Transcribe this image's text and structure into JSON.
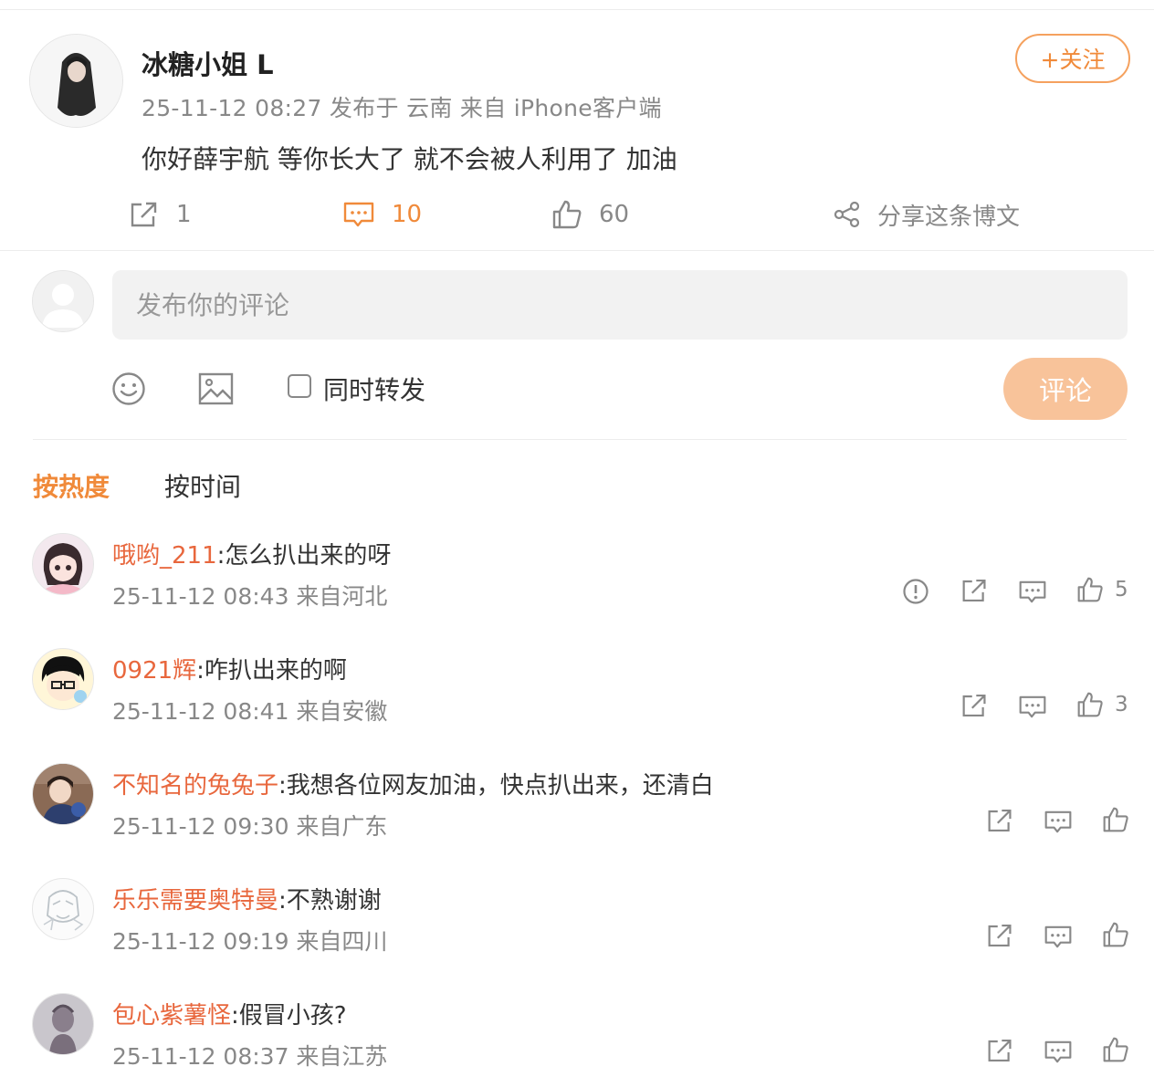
{
  "post": {
    "author": "冰糖小姐 L",
    "meta": "25-11-12 08:27  发布于 云南  来自 iPhone客户端",
    "text": "你好薛宇航 等你长大了 就不会被人利用了 加油",
    "follow_label": "+关注",
    "actions": {
      "repost_count": "1",
      "comment_count": "10",
      "like_count": "60",
      "share_label": "分享这条博文"
    }
  },
  "composer": {
    "placeholder": "发布你的评论",
    "repost_checkbox_label": "同时转发",
    "submit_label": "评论"
  },
  "sort_tabs": {
    "hot": "按热度",
    "time": "按时间"
  },
  "comments": [
    {
      "user": "哦哟_211",
      "text": ":怎么扒出来的呀",
      "meta": "25-11-12 08:43 来自河北",
      "likes": "5"
    },
    {
      "user": "0921辉",
      "text": ":咋扒出来的啊",
      "meta": "25-11-12 08:41 来自安徽",
      "likes": "3"
    },
    {
      "user": "不知名的兔兔子",
      "text": ":我想各位网友加油，快点扒出来，还清白",
      "meta": "25-11-12 09:30 来自广东",
      "likes": ""
    },
    {
      "user": "乐乐需要奥特曼",
      "text": ":不熟谢谢",
      "meta": "25-11-12 09:19 来自四川",
      "likes": ""
    },
    {
      "user": "包心紫薯怪",
      "text": ":假冒小孩?",
      "meta": "25-11-12 08:37 来自江苏",
      "likes": ""
    }
  ],
  "colors": {
    "accent": "#f08a3a",
    "username": "#e8673d",
    "submit_disabled": "#f8c39a"
  }
}
